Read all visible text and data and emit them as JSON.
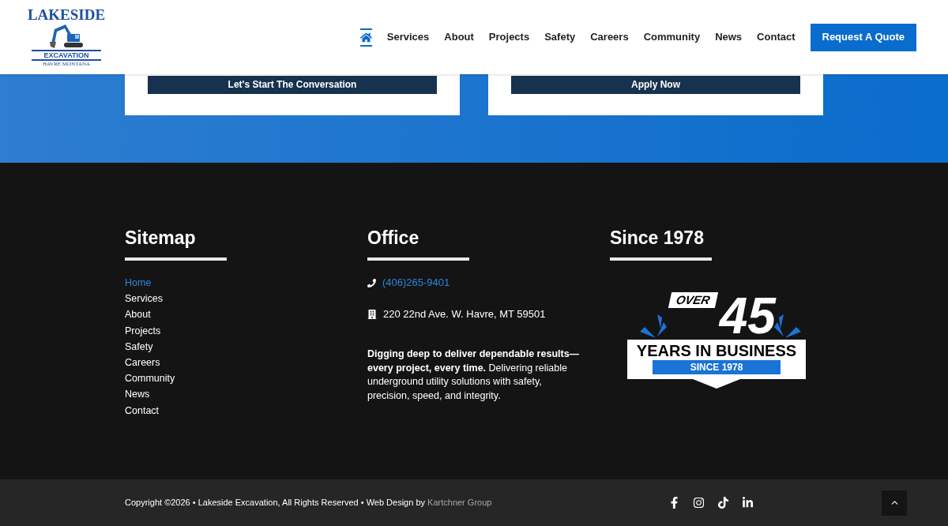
{
  "header": {
    "logo": {
      "name": "LAKESIDE",
      "subtitle": "EXCAVATION",
      "location": "HAVRE MONTANA"
    },
    "nav": [
      {
        "kind": "home",
        "selected": true
      },
      {
        "kind": "link",
        "label": "Services",
        "selected": false
      },
      {
        "kind": "link",
        "label": "About",
        "selected": false
      },
      {
        "kind": "link",
        "label": "Projects",
        "selected": false
      },
      {
        "kind": "link",
        "label": "Safety",
        "selected": false
      },
      {
        "kind": "link",
        "label": "Careers",
        "selected": false
      },
      {
        "kind": "link",
        "label": "Community",
        "selected": false
      },
      {
        "kind": "link",
        "label": "News",
        "selected": false
      },
      {
        "kind": "link",
        "label": "Contact",
        "selected": false
      }
    ],
    "cta": "Request A Quote"
  },
  "cards": [
    {
      "button": "Let's Start The Conversation"
    },
    {
      "button": "Apply Now"
    }
  ],
  "footer": {
    "sitemap": {
      "title": "Sitemap",
      "links": [
        {
          "label": "Home",
          "selected": true
        },
        {
          "label": "Services",
          "selected": false
        },
        {
          "label": "About",
          "selected": false
        },
        {
          "label": "Projects",
          "selected": false
        },
        {
          "label": "Safety",
          "selected": false
        },
        {
          "label": "Careers",
          "selected": false
        },
        {
          "label": "Community",
          "selected": false
        },
        {
          "label": "News",
          "selected": false
        },
        {
          "label": "Contact",
          "selected": false
        }
      ]
    },
    "office": {
      "title": "Office",
      "phone": "(406)265-9401",
      "address": "220 22nd Ave. W. Havre, MT 59501",
      "description": "**Digging deep to deliver dependable results—every project, every time.** Delivering reliable underground utility solutions with safety, precision, speed, and integrity."
    },
    "since": {
      "title": "Since 1978",
      "badge": {
        "over": "OVER",
        "number": "45",
        "years": "YEARS IN BUSINESS",
        "since": "SINCE 1978"
      }
    }
  },
  "bottom_bar": {
    "copyright": "Copyright ©2026 • Lakeside Excavation, All Rights Reserved • Web Design by",
    "designer": "Kartchner Group",
    "social": [
      {
        "kind": "facebook"
      },
      {
        "kind": "instagram"
      },
      {
        "kind": "tiktok"
      },
      {
        "kind": "linkedin"
      }
    ]
  }
}
